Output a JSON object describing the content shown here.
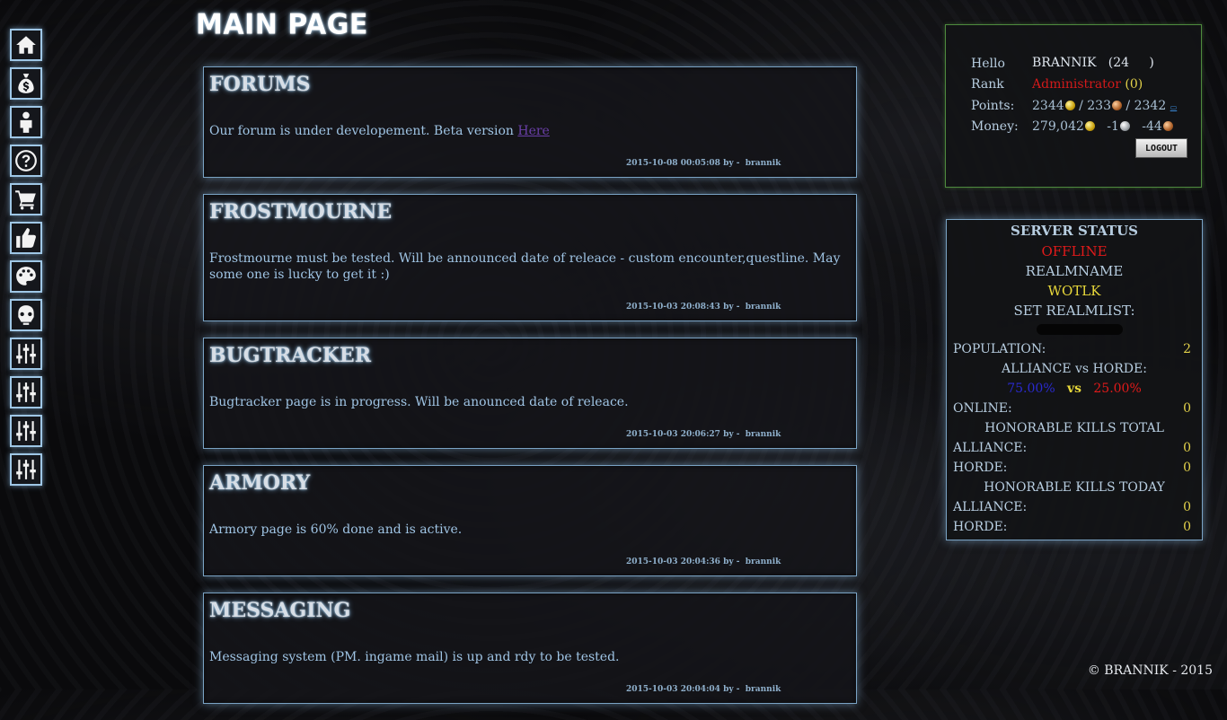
{
  "header": {
    "title": "MAIN PAGE"
  },
  "sidebar": {
    "items": [
      {
        "icon": "home-icon"
      },
      {
        "icon": "money-bag-icon"
      },
      {
        "icon": "user-icon"
      },
      {
        "icon": "help-icon"
      },
      {
        "icon": "cart-icon"
      },
      {
        "icon": "thumbs-up-icon"
      },
      {
        "icon": "palette-icon"
      },
      {
        "icon": "gas-mask-icon"
      },
      {
        "icon": "sliders-icon"
      },
      {
        "icon": "sliders-icon"
      },
      {
        "icon": "sliders-icon"
      },
      {
        "icon": "sliders-icon"
      }
    ]
  },
  "news": [
    {
      "title": "FORUMS",
      "body": "Our forum is under developement. Beta version ",
      "link": "Here",
      "date": "2015-10-08 00:05:08",
      "by": "by -",
      "author": "brannik"
    },
    {
      "title": "FROSTMOURNE",
      "body": "Frostmourne must be tested. Will be announced date of releace - custom encounter,questline. May some one is lucky to get it :)",
      "date": "2015-10-03 20:08:43",
      "by": "by -",
      "author": "brannik"
    },
    {
      "title": "BUGTRACKER",
      "body": "Bugtracker page is in progress. Will be anounced date of releace.",
      "date": "2015-10-03 20:06:27",
      "by": "by -",
      "author": "brannik"
    },
    {
      "title": "ARMORY",
      "body": "Armory page is 60% done and is active.",
      "date": "2015-10-03 20:04:36",
      "by": "by -",
      "author": "brannik"
    },
    {
      "title": "MESSAGING",
      "body": "Messaging system (PM. ingame mail) is up and rdy to be tested.",
      "date": "2015-10-03 20:04:04",
      "by": "by -",
      "author": "brannik"
    }
  ],
  "user": {
    "hello_label": "Hello",
    "name": "BRANNIK",
    "level_open": "(24",
    "level_close": ")",
    "rank_label": "Rank",
    "rank": "Administrator",
    "rank_count": "(0)",
    "points_label": "Points:",
    "points_gold": "2344",
    "points_sep1": " / 233",
    "points_sep2": " / 2342",
    "money_label": "Money:",
    "money_gold": "279,042",
    "money_silver": "-1",
    "money_copper": "-44",
    "logout_label": "LOGOUT"
  },
  "server_status": {
    "title": "SERVER STATUS",
    "state": "OFFLINE",
    "realm_label": "REALMNAME",
    "realm": "WOTLK",
    "realmlist_label": "SET REALMLIST:",
    "population_label": "POPULATION:",
    "population": "2",
    "factions_label": "ALLIANCE vs HORDE:",
    "alliance_pct": "75.00%",
    "vs": "vs",
    "horde_pct": "25.00%",
    "online_label": "ONLINE:",
    "online": "0",
    "hk_total_label": "HONORABLE KILLS TOTAL",
    "hk_total_alliance_label": "ALLIANCE:",
    "hk_total_alliance": "0",
    "hk_total_horde_label": "HORDE:",
    "hk_total_horde": "0",
    "hk_today_label": "HONORABLE KILLS TODAY",
    "hk_today_alliance_label": "ALLIANCE:",
    "hk_today_alliance": "0",
    "hk_today_horde_label": "HORDE:",
    "hk_today_horde": "0"
  },
  "colors": {
    "offline": "#e01a1a",
    "wotlk": "#e8d83a",
    "alliance": "#2a2ad0",
    "horde": "#e01a1a",
    "rank": "#d11a1a",
    "accent_border": "#7aa3c4"
  },
  "footer": {
    "text": "© BRANNIK - 2015"
  }
}
